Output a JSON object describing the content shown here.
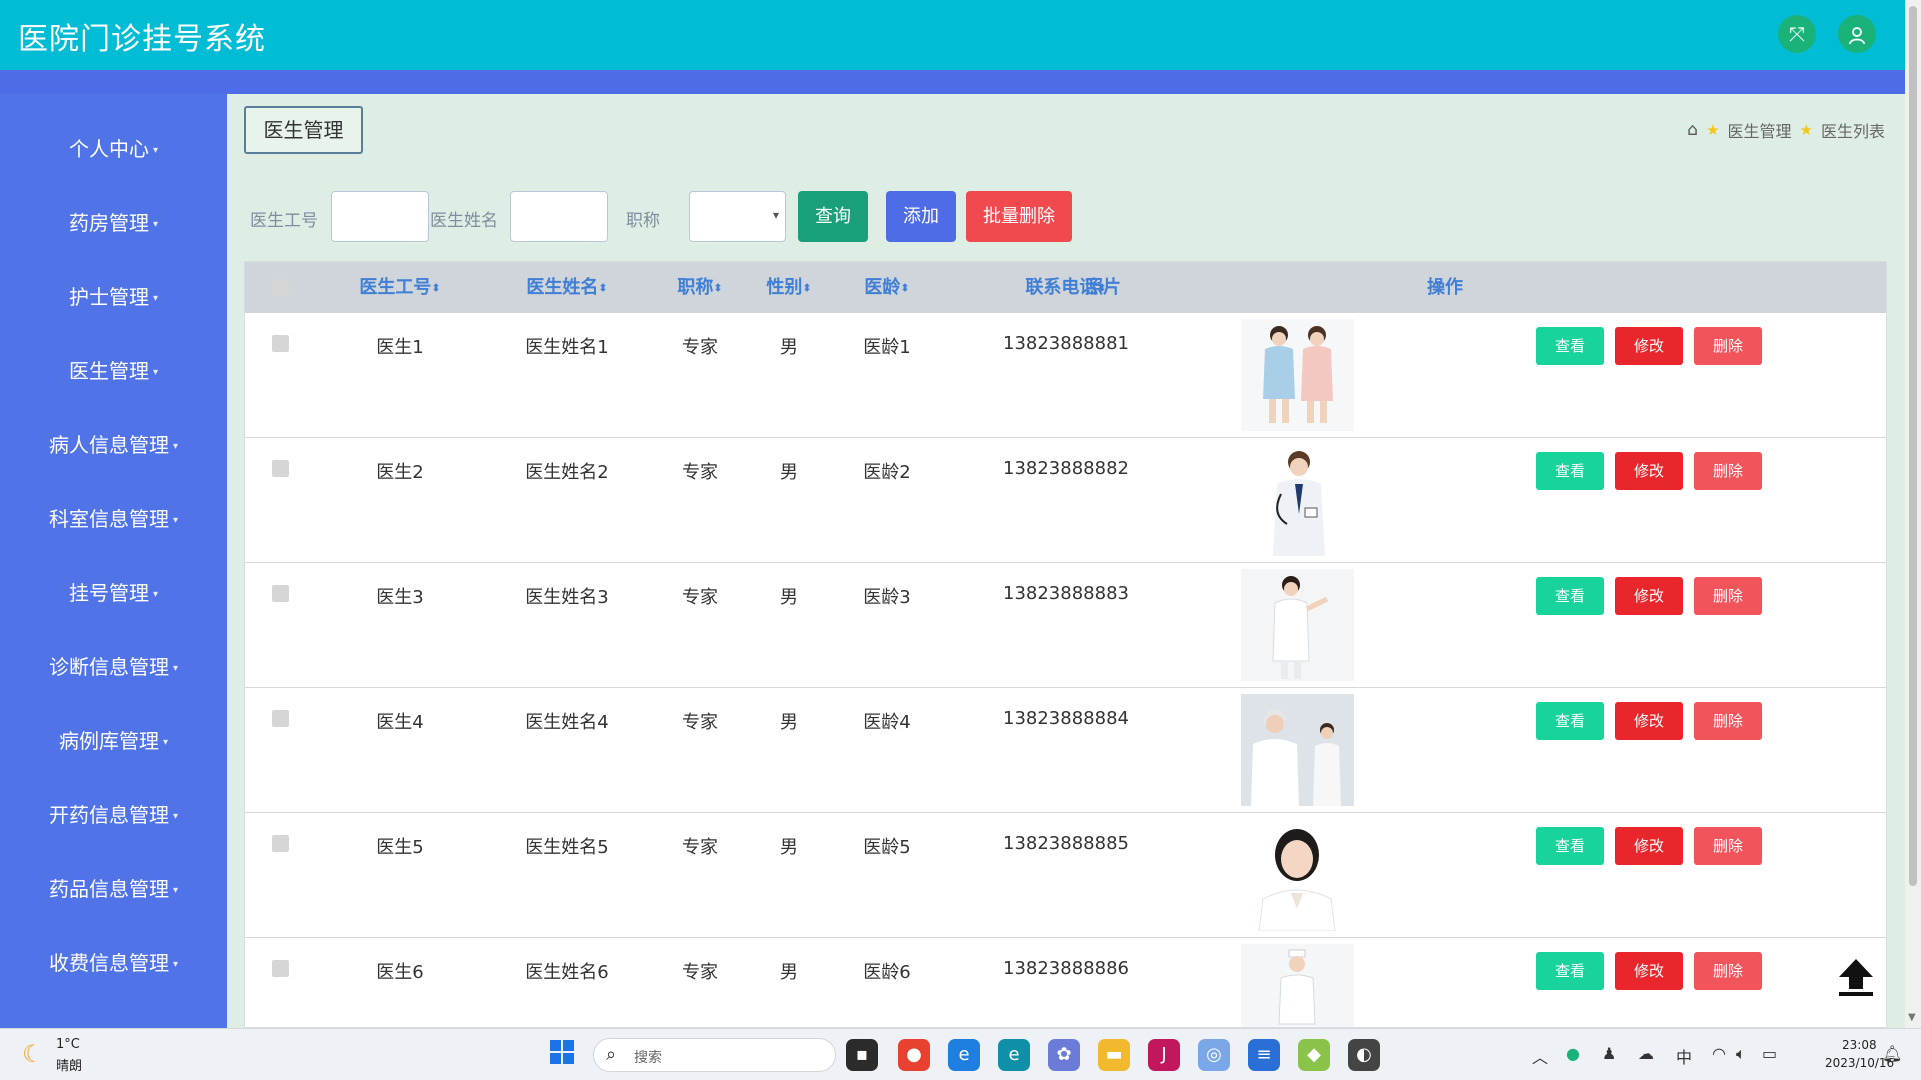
{
  "app": {
    "title": "医院门诊挂号系统"
  },
  "header": {
    "fullscreen_icon": "fullscreen-icon",
    "user_icon": "user-icon"
  },
  "sidebar": {
    "items": [
      {
        "label": "个人中心"
      },
      {
        "label": "药房管理"
      },
      {
        "label": "护士管理"
      },
      {
        "label": "医生管理"
      },
      {
        "label": "病人信息管理"
      },
      {
        "label": "科室信息管理"
      },
      {
        "label": "挂号管理"
      },
      {
        "label": "诊断信息管理"
      },
      {
        "label": "病例库管理"
      },
      {
        "label": "开药信息管理"
      },
      {
        "label": "药品信息管理"
      },
      {
        "label": "收费信息管理"
      }
    ]
  },
  "page": {
    "title": "医生管理",
    "breadcrumb": [
      "医生管理",
      "医生列表"
    ]
  },
  "filters": {
    "doctor_no_label": "医生工号",
    "doctor_no_value": "",
    "doctor_name_label": "医生姓名",
    "doctor_name_value": "",
    "title_label": "职称",
    "title_value": "",
    "query_button": "查询",
    "add_button": "添加",
    "batch_delete_button": "批量删除"
  },
  "table": {
    "columns": [
      "医生工号",
      "医生姓名",
      "职称",
      "性别",
      "医龄",
      "联系电话",
      "照片",
      "操作"
    ],
    "rows": [
      {
        "no": "医生1",
        "name": "医生姓名1",
        "title": "专家",
        "gender": "男",
        "age": "医龄1",
        "phone": "13823888881"
      },
      {
        "no": "医生2",
        "name": "医生姓名2",
        "title": "专家",
        "gender": "男",
        "age": "医龄2",
        "phone": "13823888882"
      },
      {
        "no": "医生3",
        "name": "医生姓名3",
        "title": "专家",
        "gender": "男",
        "age": "医龄3",
        "phone": "13823888883"
      },
      {
        "no": "医生4",
        "name": "医生姓名4",
        "title": "专家",
        "gender": "男",
        "age": "医龄4",
        "phone": "13823888884"
      },
      {
        "no": "医生5",
        "name": "医生姓名5",
        "title": "专家",
        "gender": "男",
        "age": "医龄5",
        "phone": "13823888885"
      },
      {
        "no": "医生6",
        "name": "医生姓名6",
        "title": "专家",
        "gender": "男",
        "age": "医龄6",
        "phone": "13823888886"
      }
    ],
    "actions": {
      "view": "查看",
      "edit": "修改",
      "delete": "删除"
    }
  },
  "taskbar": {
    "weather_temp": "1°C",
    "weather_desc": "晴朗",
    "search_placeholder": "搜索",
    "time": "23:08",
    "date": "2023/10/16"
  },
  "colors": {
    "header": "#00bcd4",
    "sidebar": "#5073e8",
    "content_bg": "#dfeee4",
    "query_btn": "#19a07a",
    "add_btn": "#4d6ce6",
    "batch_delete_btn": "#f04a4f"
  }
}
